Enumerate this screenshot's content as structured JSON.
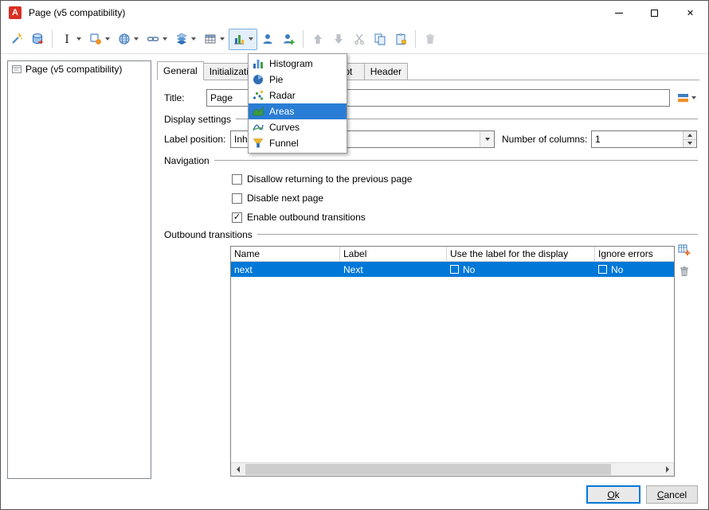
{
  "colors": {
    "accent": "#0078d7",
    "menu_highlight": "#2a7dd4",
    "app_icon_red": "#d93025",
    "selection_text": "#ffffff"
  },
  "window": {
    "title": "Page (v5 compatibility)",
    "app_icon_letter": "A"
  },
  "toolbar": {
    "icons": [
      "wand-icon",
      "datasource-icon",
      "text-style-icon",
      "component-icon",
      "globe-icon",
      "link-icon",
      "layers-icon",
      "grid-icon",
      "chart-icon",
      "user-icon",
      "add-user-icon",
      "move-up-icon",
      "move-down-icon",
      "cut-icon",
      "copy-icon",
      "paste-icon",
      "delete-icon"
    ]
  },
  "chart_menu": {
    "items": [
      {
        "label": "Histogram",
        "icon": "histogram-icon",
        "selected": false
      },
      {
        "label": "Pie",
        "icon": "pie-icon",
        "selected": false
      },
      {
        "label": "Radar",
        "icon": "radar-icon",
        "selected": false
      },
      {
        "label": "Areas",
        "icon": "areas-icon",
        "selected": true
      },
      {
        "label": "Curves",
        "icon": "curves-icon",
        "selected": false
      },
      {
        "label": "Funnel",
        "icon": "funnel-icon",
        "selected": false
      }
    ]
  },
  "tree": {
    "root_label": "Page (v5 compatibility)"
  },
  "tabs": [
    {
      "label": "General",
      "active": true
    },
    {
      "label": "Initialization",
      "active": false
    },
    {
      "label": "Script",
      "active": false
    },
    {
      "label": "Header",
      "active": false
    }
  ],
  "form": {
    "title_label": "Title:",
    "title_value": "Page",
    "display_settings_group": "Display settings",
    "label_position_label": "Label position:",
    "label_position_value": "Inherited",
    "columns_label": "Number of columns:",
    "columns_value": "1",
    "navigation_group": "Navigation",
    "checkboxes": [
      {
        "label": "Disallow returning to the previous page",
        "checked": false
      },
      {
        "label": "Disable next page",
        "checked": false
      },
      {
        "label": "Enable outbound transitions",
        "checked": true
      }
    ],
    "transitions_group": "Outbound transitions"
  },
  "transitions_table": {
    "columns": [
      "Name",
      "Label",
      "Use the label for the display",
      "Ignore errors"
    ],
    "rows": [
      {
        "name": "next",
        "label": "Next",
        "use_label": "No",
        "use_label_checked": false,
        "ignore_errors": "No",
        "ignore_errors_checked": false,
        "selected": true
      }
    ]
  },
  "footer": {
    "ok": {
      "mnemonic": "O",
      "rest": "k"
    },
    "cancel": {
      "mnemonic": "C",
      "rest": "ancel"
    }
  }
}
